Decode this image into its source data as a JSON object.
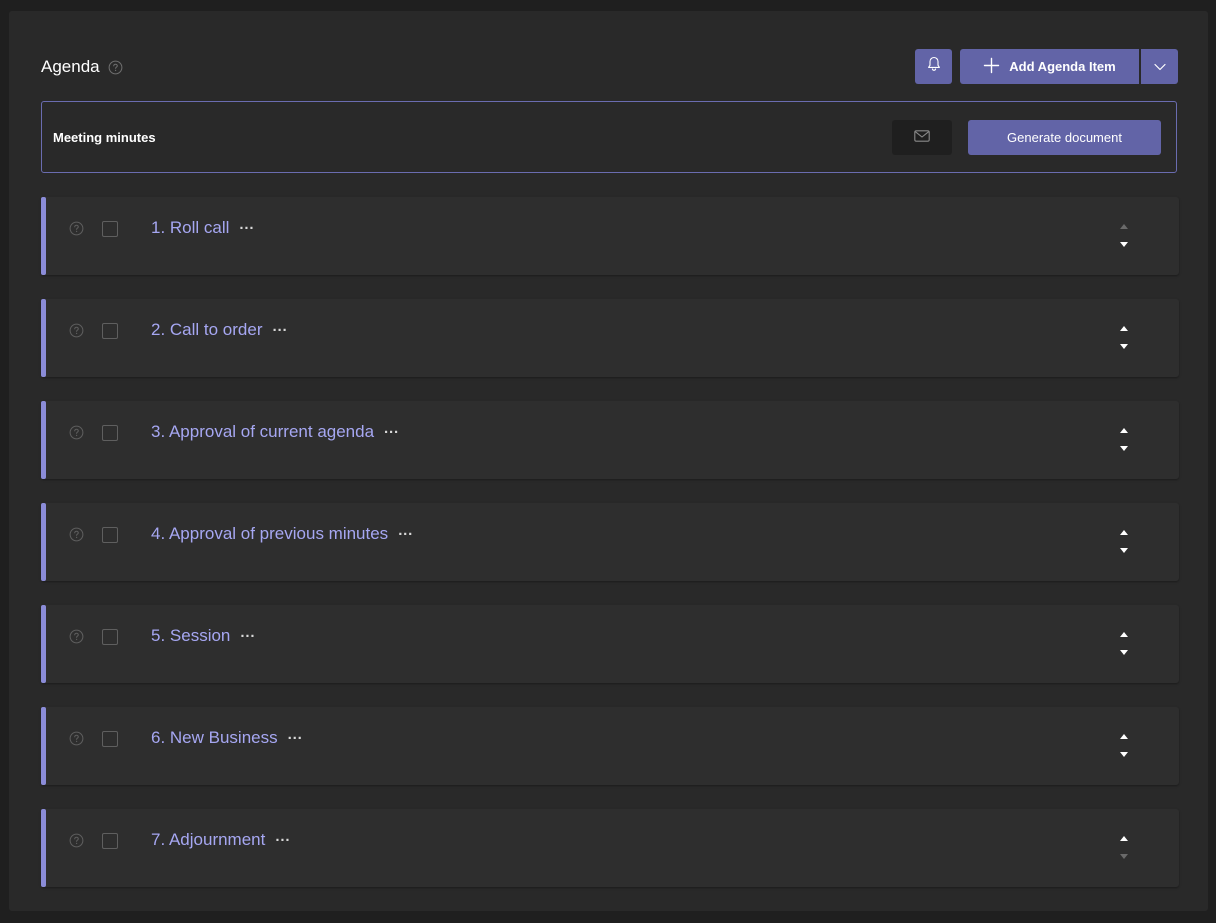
{
  "header": {
    "title": "Agenda",
    "add_label": "Add Agenda Item"
  },
  "minutes": {
    "label": "Meeting minutes",
    "generate_label": "Generate document"
  },
  "agenda_items": [
    {
      "label": "1. Roll call",
      "more": "···",
      "up_enabled": false,
      "down_enabled": true
    },
    {
      "label": "2. Call to order",
      "more": "···",
      "up_enabled": true,
      "down_enabled": true
    },
    {
      "label": "3. Approval of current agenda",
      "more": "···",
      "up_enabled": true,
      "down_enabled": true
    },
    {
      "label": "4. Approval of previous minutes",
      "more": "···",
      "up_enabled": true,
      "down_enabled": true
    },
    {
      "label": "5. Session",
      "more": "···",
      "up_enabled": true,
      "down_enabled": true
    },
    {
      "label": "6. New Business",
      "more": "···",
      "up_enabled": true,
      "down_enabled": true
    },
    {
      "label": "7. Adjournment",
      "more": "···",
      "up_enabled": true,
      "down_enabled": false
    }
  ],
  "colors": {
    "accent": "#6264a7",
    "item_title": "#a6a7f2",
    "item_bar": "#8b8cd8",
    "panel_bg": "#292929",
    "page_bg": "#1f1f1f"
  },
  "icons": [
    "help-icon",
    "bell-icon",
    "plus-icon",
    "chevron-down-icon",
    "mail-icon",
    "more-icon",
    "move-up-icon",
    "move-down-icon"
  ]
}
